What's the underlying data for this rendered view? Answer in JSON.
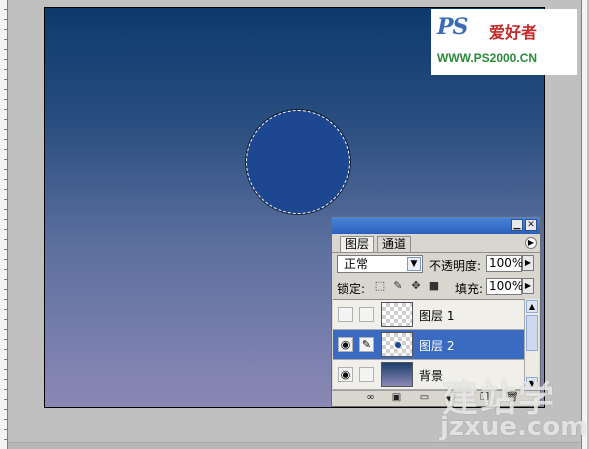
{
  "watermark": {
    "logo": "PS",
    "cn_text": "爱好者",
    "url": "WWW.PS2000.CN"
  },
  "site_watermark": {
    "cn_text": "建站学",
    "url": "jzxue.com"
  },
  "panel": {
    "tabs": [
      {
        "label": "图层"
      },
      {
        "label": "通道"
      }
    ],
    "blend_mode": "正常",
    "opacity_label": "不透明度:",
    "opacity_value": "100%",
    "lock_label": "锁定:",
    "fill_label": "填充:",
    "fill_value": "100%",
    "layers": [
      {
        "name": "图层 1",
        "visible": false,
        "selected": false
      },
      {
        "name": "图层 2",
        "visible": true,
        "selected": true
      },
      {
        "name": "背景",
        "visible": true,
        "selected": false
      }
    ]
  },
  "colors": {
    "circle_fill": "#1e4792",
    "selection_highlight": "#3a6bc0",
    "titlebar_blue": "#2a60bd"
  }
}
